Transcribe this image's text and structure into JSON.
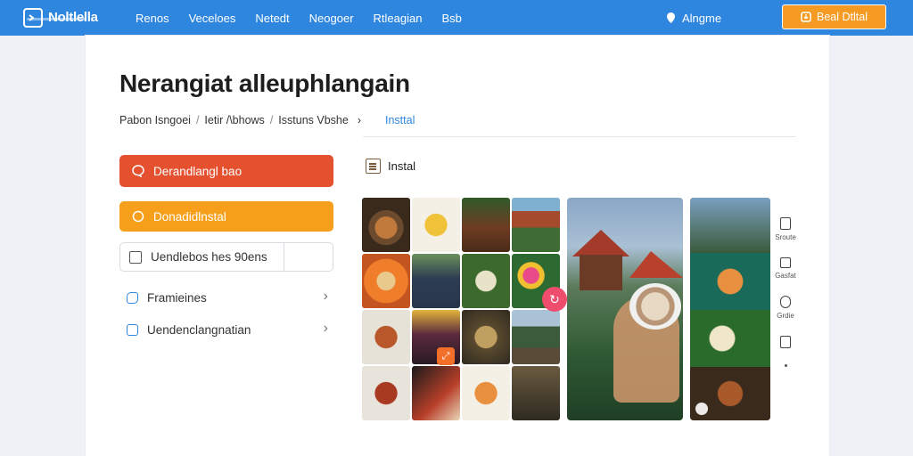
{
  "header": {
    "logo_text": "Noltlella",
    "nav": [
      "Renos",
      "Veceloes",
      "Netedt",
      "Neogoer",
      "Rtleagian",
      "Bsb"
    ],
    "language": "Alngme",
    "cta_label": "Beal Dtltal"
  },
  "page": {
    "title": "Nerangiat alleuphlangain",
    "breadcrumb": [
      "Pabon Isngoei",
      "Ietir /\\bhows",
      "Isstuns Vbshe"
    ],
    "breadcrumb_active": "Insttal"
  },
  "actions": {
    "primary_label": "Derandlangl bao",
    "secondary_label": "Donadidlnstal",
    "checkbox_label": "Uendlebos hes 90ens",
    "links": [
      {
        "label": "Framieines",
        "icon": "chat-icon"
      },
      {
        "label": "Uendenclangnatian",
        "icon": "square-icon"
      }
    ]
  },
  "gallery": {
    "heading": "Instal",
    "heading_icon": "document-icon"
  },
  "tools": [
    "Sroute",
    "Gasfat",
    "Grdie",
    ""
  ],
  "colors": {
    "header": "#2f86df",
    "accent_orange": "#f59a23",
    "primary_red": "#e5512f",
    "link_blue": "#2f86df"
  }
}
